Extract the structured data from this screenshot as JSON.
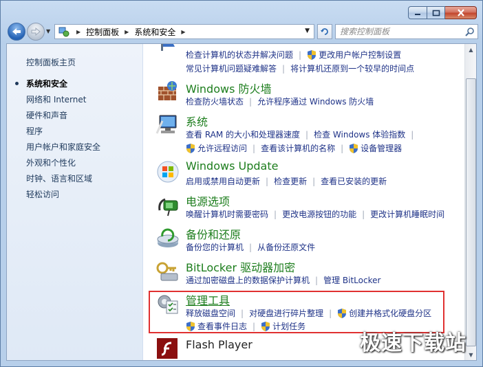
{
  "window": {
    "address": {
      "crumbs": [
        "控制面板",
        "系统和安全"
      ]
    },
    "search": {
      "placeholder": "搜索控制面板"
    }
  },
  "sidebar": {
    "home": "控制面板主页",
    "items": [
      {
        "label": "系统和安全",
        "active": true
      },
      {
        "label": "网络和 Internet"
      },
      {
        "label": "硬件和声音"
      },
      {
        "label": "程序"
      },
      {
        "label": "用户帐户和家庭安全"
      },
      {
        "label": "外观和个性化"
      },
      {
        "label": "时钟、语言和区域"
      },
      {
        "label": "轻松访问"
      }
    ]
  },
  "sections": {
    "action_center": {
      "links": [
        "检查计算机的状态并解决问题",
        "更改用户帐户控制设置",
        "常见计算机问题疑难解答",
        "将计算机还原到一个较早的时间点"
      ]
    },
    "firewall": {
      "title": "Windows 防火墙",
      "links": [
        "检查防火墙状态",
        "允许程序通过 Windows 防火墙"
      ]
    },
    "system": {
      "title": "系统",
      "links": [
        "查看 RAM 的大小和处理器速度",
        "检查 Windows 体验指数",
        "允许远程访问",
        "查看该计算机的名称",
        "设备管理器"
      ]
    },
    "update": {
      "title": "Windows Update",
      "links": [
        "启用或禁用自动更新",
        "检查更新",
        "查看已安装的更新"
      ]
    },
    "power": {
      "title": "电源选项",
      "links": [
        "唤醒计算机时需要密码",
        "更改电源按钮的功能",
        "更改计算机睡眠时间"
      ]
    },
    "backup": {
      "title": "备份和还原",
      "links": [
        "备份您的计算机",
        "从备份还原文件"
      ]
    },
    "bitlocker": {
      "title": "BitLocker 驱动器加密",
      "links": [
        "通过加密磁盘上的数据保护计算机",
        "管理 BitLocker"
      ]
    },
    "admin": {
      "title": "管理工具",
      "links": [
        "释放磁盘空间",
        "对硬盘进行碎片整理",
        "创建并格式化硬盘分区",
        "查看事件日志",
        "计划任务"
      ]
    },
    "flash": {
      "title": "Flash Player"
    }
  },
  "watermark": "极速下载站",
  "colors": {
    "title_green": "#1c7d1c",
    "link_blue": "#1e3287",
    "highlight_red": "#e03030"
  }
}
